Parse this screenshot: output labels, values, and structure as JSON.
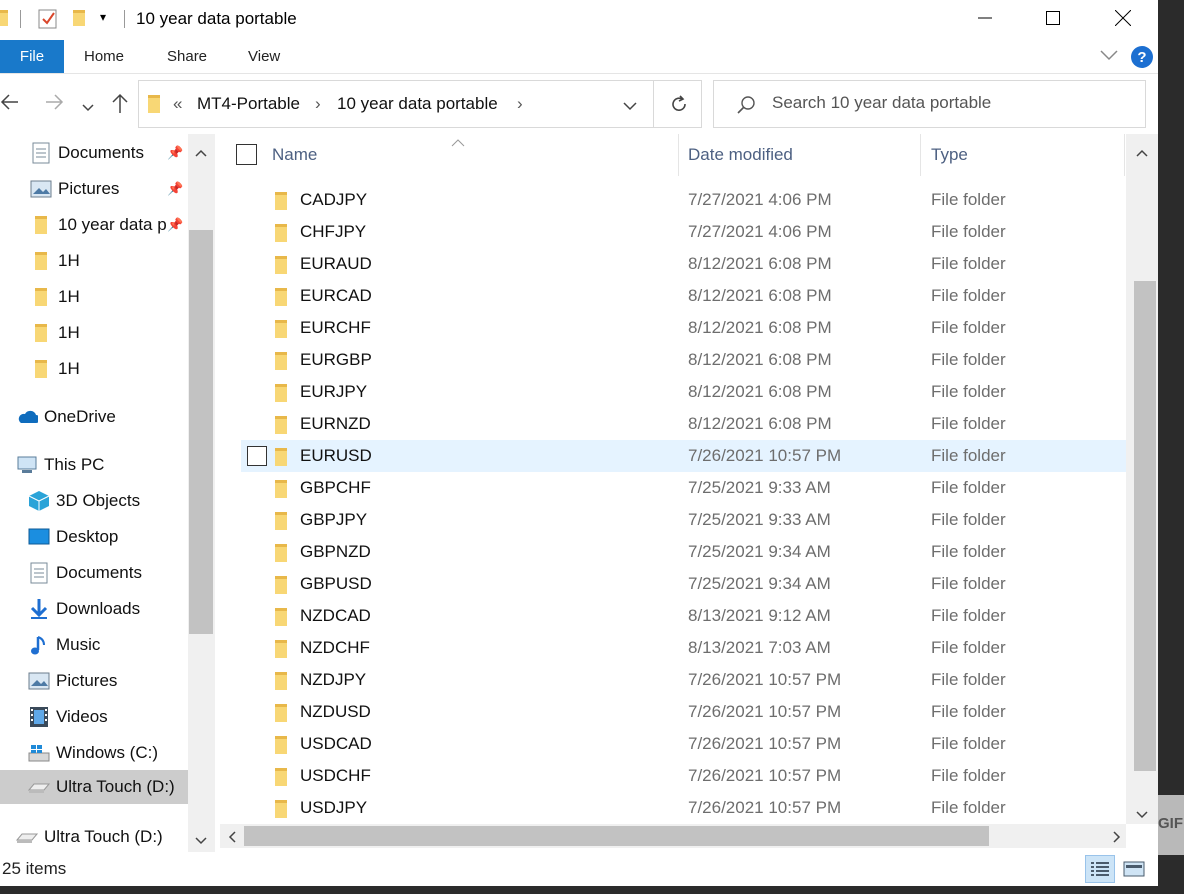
{
  "window": {
    "title": "10 year data portable"
  },
  "ribbon": {
    "tabs": [
      "File",
      "Home",
      "Share",
      "View"
    ]
  },
  "address": {
    "overflow": "«",
    "crumbs": [
      "MT4-Portable",
      "10 year data portable"
    ]
  },
  "search": {
    "placeholder": "Search 10 year data portable"
  },
  "nav": {
    "items": [
      {
        "label": "Documents",
        "icon": "documents-icon",
        "pinned": true
      },
      {
        "label": "Pictures",
        "icon": "pictures-icon",
        "pinned": true
      },
      {
        "label": "10 year data p",
        "icon": "folder-icon",
        "pinned": true
      },
      {
        "label": "1H",
        "icon": "folder-icon"
      },
      {
        "label": "1H",
        "icon": "folder-icon"
      },
      {
        "label": "1H",
        "icon": "folder-icon"
      },
      {
        "label": "1H",
        "icon": "folder-icon"
      },
      {
        "label": "OneDrive",
        "icon": "onedrive-icon"
      },
      {
        "label": "This PC",
        "icon": "this-pc-icon"
      },
      {
        "label": "3D Objects",
        "icon": "3d-objects-icon"
      },
      {
        "label": "Desktop",
        "icon": "desktop-icon"
      },
      {
        "label": "Documents",
        "icon": "documents-icon"
      },
      {
        "label": "Downloads",
        "icon": "downloads-icon"
      },
      {
        "label": "Music",
        "icon": "music-icon"
      },
      {
        "label": "Pictures",
        "icon": "pictures-icon"
      },
      {
        "label": "Videos",
        "icon": "videos-icon"
      },
      {
        "label": "Windows (C:)",
        "icon": "windows-drive-icon"
      },
      {
        "label": "Ultra Touch (D:)",
        "icon": "usb-drive-icon",
        "selected": true
      },
      {
        "label": "Ultra Touch (D:)",
        "icon": "usb-drive-icon"
      }
    ]
  },
  "columns": {
    "name": "Name",
    "date": "Date modified",
    "type": "Type"
  },
  "files": [
    {
      "name": "CADJPY",
      "date": "7/27/2021 4:06 PM",
      "type": "File folder"
    },
    {
      "name": "CHFJPY",
      "date": "7/27/2021 4:06 PM",
      "type": "File folder"
    },
    {
      "name": "EURAUD",
      "date": "8/12/2021 6:08 PM",
      "type": "File folder"
    },
    {
      "name": "EURCAD",
      "date": "8/12/2021 6:08 PM",
      "type": "File folder"
    },
    {
      "name": "EURCHF",
      "date": "8/12/2021 6:08 PM",
      "type": "File folder"
    },
    {
      "name": "EURGBP",
      "date": "8/12/2021 6:08 PM",
      "type": "File folder"
    },
    {
      "name": "EURJPY",
      "date": "8/12/2021 6:08 PM",
      "type": "File folder"
    },
    {
      "name": "EURNZD",
      "date": "8/12/2021 6:08 PM",
      "type": "File folder"
    },
    {
      "name": "EURUSD",
      "date": "7/26/2021 10:57 PM",
      "type": "File folder",
      "hover": true
    },
    {
      "name": "GBPCHF",
      "date": "7/25/2021 9:33 AM",
      "type": "File folder"
    },
    {
      "name": "GBPJPY",
      "date": "7/25/2021 9:33 AM",
      "type": "File folder"
    },
    {
      "name": "GBPNZD",
      "date": "7/25/2021 9:34 AM",
      "type": "File folder"
    },
    {
      "name": "GBPUSD",
      "date": "7/25/2021 9:34 AM",
      "type": "File folder"
    },
    {
      "name": "NZDCAD",
      "date": "8/13/2021 9:12 AM",
      "type": "File folder"
    },
    {
      "name": "NZDCHF",
      "date": "8/13/2021 7:03 AM",
      "type": "File folder"
    },
    {
      "name": "NZDJPY",
      "date": "7/26/2021 10:57 PM",
      "type": "File folder"
    },
    {
      "name": "NZDUSD",
      "date": "7/26/2021 10:57 PM",
      "type": "File folder"
    },
    {
      "name": "USDCAD",
      "date": "7/26/2021 10:57 PM",
      "type": "File folder"
    },
    {
      "name": "USDCHF",
      "date": "7/26/2021 10:57 PM",
      "type": "File folder"
    },
    {
      "name": "USDJPY",
      "date": "7/26/2021 10:57 PM",
      "type": "File folder"
    }
  ],
  "status": {
    "count": "25 items"
  },
  "overlay": {
    "badge": "GIF"
  },
  "colors": {
    "accent": "#1979ca",
    "folder": "#f8d775",
    "hover": "#e5f3ff",
    "selected": "#cccccc"
  }
}
